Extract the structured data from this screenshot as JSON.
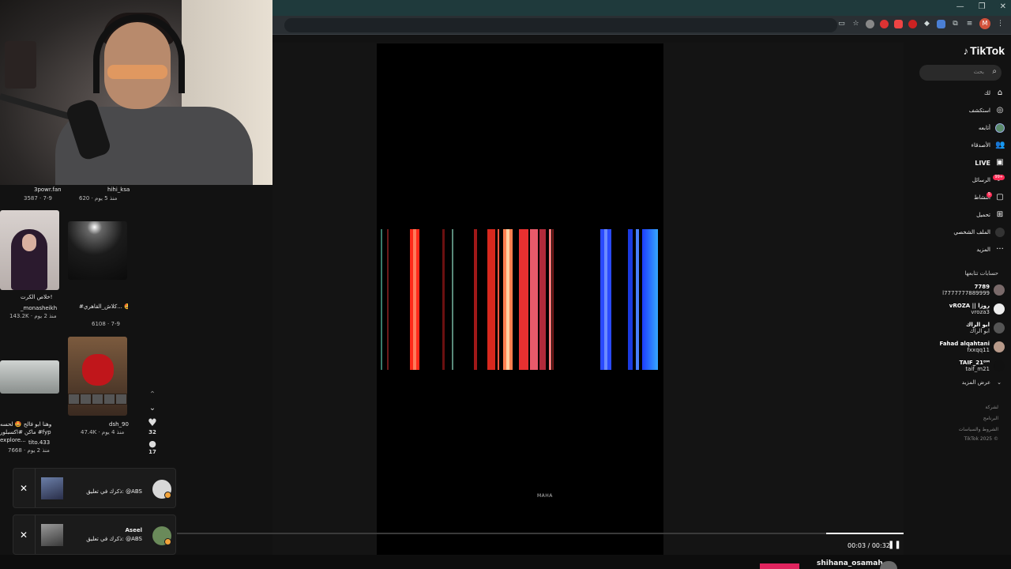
{
  "brand": {
    "name": "TikTok"
  },
  "search": {
    "placeholder": "بحث"
  },
  "nav": [
    {
      "label": "لك",
      "icon": "home-icon"
    },
    {
      "label": "استكشف",
      "icon": "compass-icon"
    },
    {
      "label": "أتابعه",
      "icon": "following-avatar-icon"
    },
    {
      "label": "الأصدقاء",
      "icon": "friends-icon"
    },
    {
      "label": "LIVE",
      "icon": "live-icon"
    },
    {
      "label": "الرسائل",
      "icon": "messages-icon",
      "badge": "99+"
    },
    {
      "label": "النشاط",
      "icon": "activity-icon",
      "badge": "5"
    },
    {
      "label": "تحميل",
      "icon": "upload-icon"
    },
    {
      "label": "الملف الشخصي",
      "icon": "profile-icon"
    },
    {
      "label": "المزيد",
      "icon": "more-dots-icon"
    }
  ],
  "following": {
    "title": "حسابات تتابعها",
    "accounts": [
      {
        "name": "7789",
        "handle": "l7777777889999"
      },
      {
        "name": "vROZA || روزا",
        "handle": "vroza3"
      },
      {
        "name": "ابو الراك",
        "handle": "ابو الراك"
      },
      {
        "name": "Fahad alqahtani",
        "handle": "fxxqq11"
      },
      {
        "name": "TAIF_21ᴰᴹ",
        "handle": "taif_m21"
      }
    ],
    "more": "عرض المزيد"
  },
  "footer": [
    "لشركة",
    "البرنامج",
    "الشروط والسياسات",
    "TikTok 2025 ©"
  ],
  "player": {
    "time": "00:03 / 00:32",
    "watermark": "MAHA",
    "progress": 0.094
  },
  "actions": {
    "likes": "32",
    "comments": "17"
  },
  "feed": [
    {
      "user": "3powr.fan",
      "meta": "3587 · 7-9",
      "caption": ""
    },
    {
      "user": "hihi_ksa",
      "meta": "620 · منذ 5 يوم",
      "caption": ""
    },
    {
      "user": "_monasheikh",
      "meta": "143.2K · منذ 2 يوم",
      "caption": "خلاص الكرت!"
    },
    {
      "user": "",
      "meta": "6108 · 7-9",
      "caption": "#كلاش_القاهري... 🤩🤩"
    },
    {
      "user": "tito.433",
      "meta": "7668 · منذ 2 يوم",
      "caption": "وهنا ابو فالح 🤩 لحسه ماكن #اكسبلور #fyp explore..."
    },
    {
      "user": "dsh_90",
      "meta": "47.4K · منذ 4 يوم",
      "caption": ""
    }
  ],
  "notifications": [
    {
      "name": "",
      "text": "ذكرك في تعليق: @ABS"
    },
    {
      "name": "Aseel",
      "text": "ذكرك في تعليق: @ABS"
    }
  ],
  "bottom": {
    "username": "shihana_osamah"
  },
  "colors": {
    "accent": "#fe2c55",
    "background": "#121212",
    "video": "#000000"
  }
}
